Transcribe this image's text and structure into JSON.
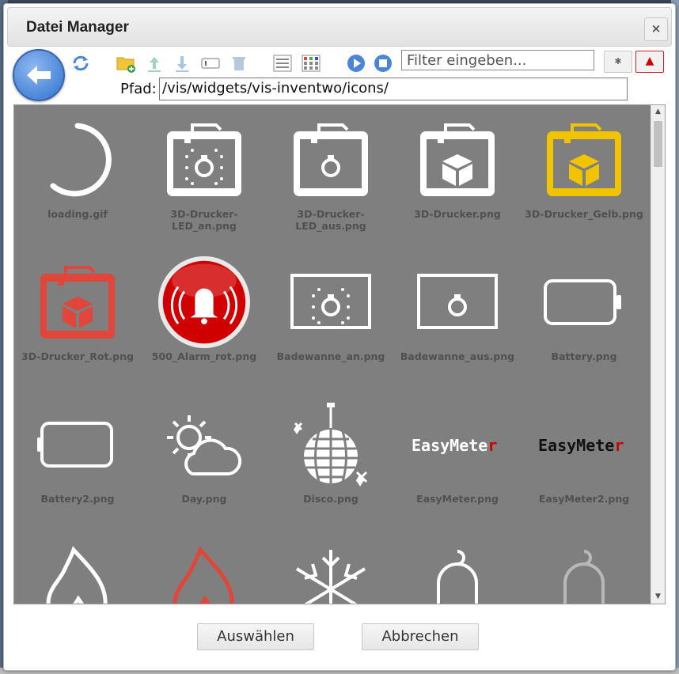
{
  "dialog": {
    "title": "Datei Manager",
    "close_label": "×"
  },
  "toolbar": {
    "icons": [
      "back-arrow-icon",
      "refresh-icon",
      "new-folder-icon",
      "upload-icon",
      "download-icon",
      "rename-icon",
      "delete-icon",
      "list-view-icon",
      "table-view-icon",
      "play-icon",
      "stop-icon"
    ],
    "filter_placeholder": "Filter eingeben...",
    "settings_label": "✱",
    "alert_label": "▲"
  },
  "path": {
    "label": "Pfad:",
    "value": "/vis/widgets/vis-inventwo/icons/"
  },
  "files": [
    {
      "name": "loading.gif",
      "icon": "loading-ring-icon"
    },
    {
      "name": "3D-Drucker-LED_an.png",
      "icon": "printer-led-on-icon"
    },
    {
      "name": "3D-Drucker-LED_aus.png",
      "icon": "printer-led-off-icon"
    },
    {
      "name": "3D-Drucker.png",
      "icon": "printer-box-icon"
    },
    {
      "name": "3D-Drucker_Gelb.png",
      "icon": "printer-yellow-icon"
    },
    {
      "name": "3D-Drucker_Rot.png",
      "icon": "printer-red-icon"
    },
    {
      "name": "500_Alarm_rot.png",
      "icon": "alarm-bell-red-icon"
    },
    {
      "name": "Badewanne_an.png",
      "icon": "bathtub-on-icon"
    },
    {
      "name": "Badewanne_aus.png",
      "icon": "bathtub-off-icon"
    },
    {
      "name": "Battery.png",
      "icon": "battery-icon"
    },
    {
      "name": "Battery2.png",
      "icon": "battery2-icon"
    },
    {
      "name": "Day.png",
      "icon": "sun-cloud-icon"
    },
    {
      "name": "Disco.png",
      "icon": "disco-ball-icon"
    },
    {
      "name": "EasyMeter.png",
      "icon": "easymeter-icon"
    },
    {
      "name": "EasyMeter2.png",
      "icon": "easymeter2-icon"
    },
    {
      "name": "",
      "icon": "flame-white-icon"
    },
    {
      "name": "",
      "icon": "flame-red-icon"
    },
    {
      "name": "",
      "icon": "snowflake-icon"
    },
    {
      "name": "",
      "icon": "bell-white-icon"
    },
    {
      "name": "",
      "icon": "bell-grey-icon"
    }
  ],
  "easymeter_text": "EasyMete",
  "easymeter_suffix": "r",
  "buttons": {
    "select": "Auswählen",
    "cancel": "Abbrechen"
  },
  "colors": {
    "list_bg": "#7f7f7f",
    "yellow": "#f0c400",
    "red": "#e0463a",
    "alarm_red": "#d00000",
    "back_blue": "#4a86d8"
  }
}
